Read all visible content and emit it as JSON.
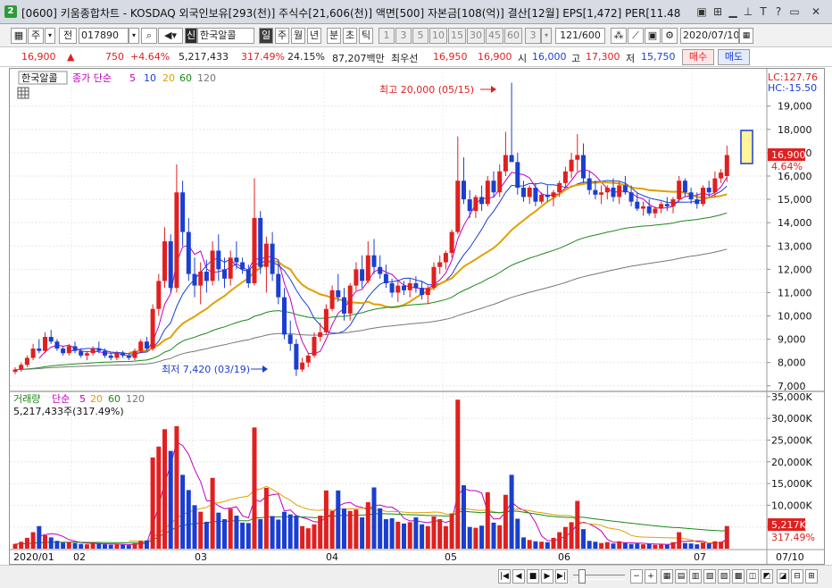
{
  "window": {
    "badge": "2",
    "title": "[0600] 키움종합차트 - KOSDAQ 외국인보유[293(천)] 주식수[21,606(천)] 액면[500] 자본금[108(억)] 결산[12월] EPS[1,472] PER[11.48",
    "controls": [
      "▣",
      "⊞",
      "T",
      "?",
      "✕"
    ]
  },
  "toolbar": {
    "type_label": "주",
    "prev_label": "전",
    "code_value": "017890",
    "name_prefix": "신",
    "name_value": "한국알콜",
    "period_buttons": [
      "일",
      "주",
      "월",
      "년",
      "분",
      "초",
      "틱"
    ],
    "interval_buttons": [
      "1",
      "3",
      "5",
      "10",
      "15",
      "30",
      "45",
      "60"
    ],
    "count_value": "3",
    "range_value": "121/600",
    "date_value": "2020/07/10"
  },
  "quote": {
    "price": "16,900",
    "arrow": "▲",
    "change": "750",
    "change_pct": "+4.64%",
    "volume": "5,217,433",
    "volume_ratio": "317.49%",
    "turnover": "24.15%",
    "amount": "87,207백만",
    "best_ask_label": "최우선",
    "best_ask": "16,950",
    "best_bid": "16,900",
    "open_label": "시",
    "open": "16,000",
    "high_label": "고",
    "high": "17,300",
    "low_label": "저",
    "low": "15,750",
    "buy_label": "매수",
    "sell_label": "매도"
  },
  "price_panel": {
    "stock_name": "한국알콜",
    "legend": [
      {
        "label": "종가 단순",
        "color": "#c000c0"
      },
      {
        "label": "5",
        "color": "#c000c0"
      },
      {
        "label": "10",
        "color": "#1a3fd0"
      },
      {
        "label": "20",
        "color": "#e0a000"
      },
      {
        "label": "60",
        "color": "#1a8a1a"
      },
      {
        "label": "120",
        "color": "#777777"
      }
    ],
    "lc": "LC:127.76",
    "hc": "HC:-15.50",
    "high_annot": "최고 20,000 (05/15)",
    "low_annot": "최저 7,420 (03/19)",
    "last_price_tag": "16,900",
    "last_pct_tag": "4.64%"
  },
  "volume_panel": {
    "legend_title": "거래량",
    "legend": [
      {
        "label": "단순",
        "color": "#c000c0"
      },
      {
        "label": "5",
        "color": "#c000c0"
      },
      {
        "label": "20",
        "color": "#e0a000"
      },
      {
        "label": "60",
        "color": "#1a8a1a"
      },
      {
        "label": "120",
        "color": "#777777"
      }
    ],
    "current_volume": "5,217,433주(317.49%)",
    "last_volume_tag": "5,217K",
    "last_pct_tag": "317.49%"
  },
  "axis": {
    "date_labels": [
      "2020/01",
      "02",
      "03",
      "04",
      "05",
      "06",
      "07"
    ],
    "date_tail": "07/10"
  },
  "colors": {
    "up": "#e02020",
    "down": "#1a3fd0",
    "ma5": "#c000c0",
    "ma10": "#1a3fd0",
    "ma20": "#e0a000",
    "ma60": "#1a8a1a",
    "ma120": "#777777"
  },
  "chart_data": {
    "type": "candlestick",
    "price_axis": {
      "ticks": [
        7000,
        8000,
        9000,
        10000,
        11000,
        12000,
        13000,
        14000,
        15000,
        16000,
        17000,
        18000,
        19000
      ],
      "range": [
        6800,
        20600
      ]
    },
    "volume_axis": {
      "ticks": [
        5000,
        10000,
        15000,
        20000,
        25000,
        30000,
        35000
      ],
      "unit": "K",
      "range": [
        0,
        36000
      ]
    },
    "candles": [
      [
        7600,
        7800,
        7500,
        7700
      ],
      [
        7700,
        8000,
        7600,
        7900
      ],
      [
        7900,
        8300,
        7800,
        8200
      ],
      [
        8200,
        8800,
        8100,
        8600
      ],
      [
        8600,
        9000,
        8400,
        8500
      ],
      [
        8500,
        9300,
        8400,
        9100
      ],
      [
        9100,
        9400,
        8800,
        8900
      ],
      [
        8900,
        9000,
        8500,
        8600
      ],
      [
        8600,
        8700,
        8300,
        8400
      ],
      [
        8400,
        8800,
        8300,
        8700
      ],
      [
        8700,
        8900,
        8400,
        8500
      ],
      [
        8500,
        8600,
        8200,
        8300
      ],
      [
        8300,
        8500,
        8100,
        8400
      ],
      [
        8400,
        8700,
        8300,
        8600
      ],
      [
        8600,
        8900,
        8400,
        8500
      ],
      [
        8500,
        8600,
        8200,
        8300
      ],
      [
        8300,
        8400,
        8100,
        8200
      ],
      [
        8200,
        8500,
        8100,
        8400
      ],
      [
        8400,
        8500,
        8200,
        8300
      ],
      [
        8300,
        8400,
        8100,
        8200
      ],
      [
        8200,
        8600,
        8100,
        8500
      ],
      [
        8500,
        9000,
        8400,
        8900
      ],
      [
        8900,
        9100,
        8500,
        8600
      ],
      [
        8600,
        10500,
        8500,
        10300
      ],
      [
        10300,
        11800,
        10000,
        11500
      ],
      [
        11500,
        13800,
        11200,
        13200
      ],
      [
        13200,
        13500,
        11000,
        11200
      ],
      [
        11200,
        16500,
        11000,
        15300
      ],
      [
        15300,
        15800,
        13000,
        13600
      ],
      [
        13600,
        14200,
        11500,
        11800
      ],
      [
        11800,
        12500,
        10800,
        11300
      ],
      [
        11300,
        12300,
        10500,
        11900
      ],
      [
        11900,
        12400,
        11000,
        11500
      ],
      [
        11500,
        13200,
        11300,
        12800
      ],
      [
        12800,
        13500,
        11500,
        12000
      ],
      [
        12000,
        12500,
        11200,
        11600
      ],
      [
        11600,
        12800,
        11300,
        12500
      ],
      [
        12500,
        13200,
        12000,
        12300
      ],
      [
        12300,
        12500,
        11800,
        12000
      ],
      [
        12000,
        12200,
        11200,
        11400
      ],
      [
        11400,
        15900,
        11300,
        14200
      ],
      [
        14200,
        14500,
        11800,
        12100
      ],
      [
        12100,
        13400,
        11000,
        13100
      ],
      [
        13100,
        13600,
        11500,
        11800
      ],
      [
        11800,
        12400,
        10500,
        10800
      ],
      [
        10800,
        11200,
        9000,
        9200
      ],
      [
        9200,
        9800,
        8500,
        8800
      ],
      [
        8800,
        9000,
        7420,
        7700
      ],
      [
        7700,
        8200,
        7600,
        8000
      ],
      [
        8000,
        8400,
        7800,
        8300
      ],
      [
        8300,
        9300,
        8200,
        9100
      ],
      [
        9100,
        9700,
        8900,
        9300
      ],
      [
        9300,
        10500,
        9200,
        10300
      ],
      [
        10300,
        11300,
        10200,
        11100
      ],
      [
        11100,
        11800,
        10600,
        10800
      ],
      [
        10800,
        11200,
        9800,
        10100
      ],
      [
        10100,
        11400,
        9800,
        11300
      ],
      [
        11300,
        12300,
        11100,
        12000
      ],
      [
        12000,
        12600,
        11200,
        11500
      ],
      [
        11500,
        13200,
        11400,
        12600
      ],
      [
        12600,
        13300,
        11800,
        12100
      ],
      [
        12100,
        12600,
        11600,
        11800
      ],
      [
        11800,
        12200,
        11200,
        11400
      ],
      [
        11400,
        11600,
        10800,
        11000
      ],
      [
        11000,
        11500,
        10600,
        11300
      ],
      [
        11300,
        11500,
        10900,
        11100
      ],
      [
        11100,
        11600,
        10800,
        11400
      ],
      [
        11400,
        11700,
        11000,
        11200
      ],
      [
        11200,
        11500,
        10700,
        10900
      ],
      [
        10900,
        11300,
        10500,
        11200
      ],
      [
        11200,
        12300,
        11100,
        12100
      ],
      [
        12100,
        12600,
        11800,
        12300
      ],
      [
        12300,
        12800,
        12000,
        12700
      ],
      [
        12700,
        13700,
        12500,
        13600
      ],
      [
        13600,
        17700,
        13500,
        15800
      ],
      [
        15800,
        16800,
        14800,
        15000
      ],
      [
        15000,
        15400,
        14200,
        14500
      ],
      [
        14500,
        15200,
        14200,
        15100
      ],
      [
        15100,
        15600,
        14500,
        14800
      ],
      [
        14800,
        16000,
        14700,
        15800
      ],
      [
        15800,
        16200,
        15100,
        15300
      ],
      [
        15300,
        16500,
        15100,
        16200
      ],
      [
        16200,
        17900,
        16000,
        16900
      ],
      [
        16900,
        20000,
        16700,
        16600
      ],
      [
        16600,
        17000,
        15200,
        15500
      ],
      [
        15500,
        15800,
        14900,
        15100
      ],
      [
        15100,
        15600,
        14800,
        15500
      ],
      [
        15500,
        15700,
        14700,
        14900
      ],
      [
        14900,
        15300,
        14800,
        15200
      ],
      [
        15200,
        15600,
        14900,
        15100
      ],
      [
        15100,
        15400,
        14700,
        15300
      ],
      [
        15300,
        15800,
        15100,
        15700
      ],
      [
        15700,
        16400,
        15500,
        16200
      ],
      [
        16200,
        17000,
        15900,
        16700
      ],
      [
        16700,
        17800,
        16200,
        16900
      ],
      [
        16900,
        17400,
        15700,
        15900
      ],
      [
        15900,
        16200,
        15200,
        15400
      ],
      [
        15400,
        15800,
        15000,
        15200
      ],
      [
        15200,
        15600,
        14800,
        15300
      ],
      [
        15300,
        15600,
        15000,
        15500
      ],
      [
        15500,
        15900,
        14900,
        15100
      ],
      [
        15100,
        15800,
        14800,
        15600
      ],
      [
        15600,
        16000,
        15200,
        15300
      ],
      [
        15300,
        15600,
        14700,
        14900
      ],
      [
        14900,
        15300,
        14500,
        14600
      ],
      [
        14600,
        14900,
        14300,
        14700
      ],
      [
        14700,
        15000,
        14300,
        14400
      ],
      [
        14400,
        14700,
        14200,
        14600
      ],
      [
        14600,
        14900,
        14400,
        14800
      ],
      [
        14800,
        15100,
        14500,
        14700
      ],
      [
        14700,
        15100,
        14400,
        15000
      ],
      [
        15000,
        16000,
        14900,
        15800
      ],
      [
        15800,
        15900,
        15100,
        15300
      ],
      [
        15300,
        15500,
        14800,
        15000
      ],
      [
        15000,
        15300,
        14600,
        14800
      ],
      [
        14800,
        15600,
        14700,
        15500
      ],
      [
        15500,
        15800,
        15100,
        15300
      ],
      [
        15300,
        16200,
        15100,
        15900
      ],
      [
        15900,
        16300,
        15700,
        16150
      ],
      [
        16000,
        17300,
        15750,
        16900
      ]
    ],
    "volumes_k": [
      1100,
      1600,
      2500,
      3800,
      5200,
      3100,
      2600,
      1800,
      1400,
      1500,
      1300,
      1100,
      1000,
      1400,
      1200,
      1000,
      900,
      1000,
      900,
      800,
      1200,
      1800,
      1900,
      21000,
      23500,
      27500,
      22500,
      28200,
      17000,
      13500,
      10000,
      8500,
      6200,
      16300,
      8300,
      6800,
      9200,
      7600,
      6000,
      5900,
      27900,
      6800,
      14000,
      7500,
      6700,
      8500,
      7900,
      7600,
      5200,
      4700,
      5600,
      7600,
      13400,
      8700,
      13400,
      9200,
      8700,
      9000,
      7200,
      10700,
      14100,
      9300,
      6800,
      7000,
      6200,
      5800,
      6100,
      7200,
      5600,
      5200,
      7400,
      6800,
      5200,
      8100,
      34300,
      14600,
      5000,
      4800,
      5300,
      13000,
      6000,
      5400,
      12400,
      17000,
      6900,
      2600,
      2000,
      1700,
      1600,
      1500,
      2500,
      3800,
      5000,
      6100,
      11000,
      4500,
      1800,
      1600,
      1300,
      1500,
      1200,
      1700,
      1300,
      1100,
      1200,
      1000,
      1100,
      900,
      1000,
      900,
      1500,
      3800,
      1300,
      1200,
      1000,
      1400,
      1200,
      1700,
      1600,
      5217
    ]
  }
}
